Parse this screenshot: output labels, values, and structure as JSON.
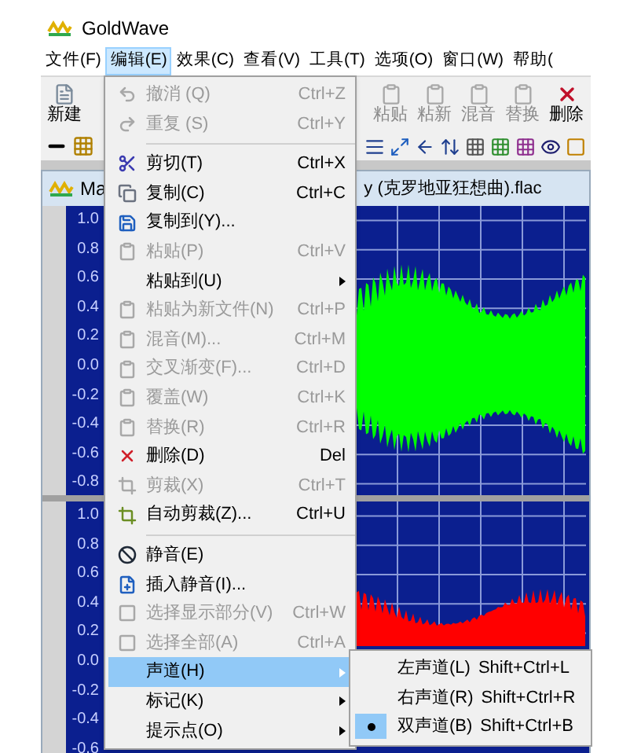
{
  "app": {
    "title": "GoldWave"
  },
  "menubar": [
    {
      "label": "文件(F)",
      "selected": false
    },
    {
      "label": "编辑(E)",
      "selected": true
    },
    {
      "label": "效果(C)",
      "selected": false
    },
    {
      "label": "查看(V)",
      "selected": false
    },
    {
      "label": "工具(T)",
      "selected": false
    },
    {
      "label": "选项(O)",
      "selected": false
    },
    {
      "label": "窗口(W)",
      "selected": false
    },
    {
      "label": "帮助(",
      "selected": false
    }
  ],
  "toolbar_left": [
    {
      "label": "新建",
      "disabled": false
    }
  ],
  "toolbar_right": [
    {
      "label": "粘贴",
      "disabled": true
    },
    {
      "label": "粘新",
      "disabled": true
    },
    {
      "label": "混音",
      "disabled": true
    },
    {
      "label": "替换",
      "disabled": true
    },
    {
      "label": "删除",
      "disabled": false
    }
  ],
  "document": {
    "title_start": "Ma",
    "title_end": "y (克罗地亚狂想曲).flac",
    "top_axis": [
      "1.0",
      "0.8",
      "0.6",
      "0.4",
      "0.2",
      "0.0",
      "-0.2",
      "-0.4",
      "-0.6",
      "-0.8"
    ],
    "bottom_axis": [
      "1.0",
      "0.8",
      "0.6",
      "0.4",
      "0.2",
      "0.0",
      "-0.2",
      "-0.4",
      "-0.6"
    ]
  },
  "edit_menu": {
    "items": [
      {
        "kind": "item",
        "label": "撤消 (Q)",
        "shortcut": "Ctrl+Z",
        "disabled": true,
        "selected": false
      },
      {
        "kind": "item",
        "label": "重复 (S)",
        "shortcut": "Ctrl+Y",
        "disabled": true,
        "selected": false
      },
      {
        "kind": "separator"
      },
      {
        "kind": "item",
        "label": "剪切(T)",
        "shortcut": "Ctrl+X",
        "disabled": false,
        "selected": false
      },
      {
        "kind": "item",
        "label": "复制(C)",
        "shortcut": "Ctrl+C",
        "disabled": false,
        "selected": false
      },
      {
        "kind": "item",
        "label": "复制到(Y)...",
        "disabled": false,
        "selected": false
      },
      {
        "kind": "item",
        "label": "粘贴(P)",
        "shortcut": "Ctrl+V",
        "disabled": true,
        "selected": false
      },
      {
        "kind": "submenu",
        "label": "粘贴到(U)",
        "disabled": false,
        "selected": false
      },
      {
        "kind": "item",
        "label": "粘贴为新文件(N)",
        "shortcut": "Ctrl+P",
        "disabled": true,
        "selected": false
      },
      {
        "kind": "item",
        "label": "混音(M)...",
        "shortcut": "Ctrl+M",
        "disabled": true,
        "selected": false
      },
      {
        "kind": "item",
        "label": "交叉渐变(F)...",
        "shortcut": "Ctrl+D",
        "disabled": true,
        "selected": false
      },
      {
        "kind": "item",
        "label": "覆盖(W)",
        "shortcut": "Ctrl+K",
        "disabled": true,
        "selected": false
      },
      {
        "kind": "item",
        "label": "替换(R)",
        "shortcut": "Ctrl+R",
        "disabled": true,
        "selected": false
      },
      {
        "kind": "item",
        "label": "删除(D)",
        "shortcut": "Del",
        "disabled": false,
        "selected": false
      },
      {
        "kind": "item",
        "label": "剪裁(X)",
        "shortcut": "Ctrl+T",
        "disabled": true,
        "selected": false
      },
      {
        "kind": "item",
        "label": "自动剪裁(Z)...",
        "shortcut": "Ctrl+U",
        "disabled": false,
        "selected": false
      },
      {
        "kind": "separator"
      },
      {
        "kind": "item",
        "label": "静音(E)",
        "disabled": false,
        "selected": false
      },
      {
        "kind": "item",
        "label": "插入静音(I)...",
        "disabled": false,
        "selected": false
      },
      {
        "kind": "item",
        "label": "选择显示部分(V)",
        "shortcut": "Ctrl+W",
        "disabled": true,
        "selected": false
      },
      {
        "kind": "item",
        "label": "选择全部(A)",
        "shortcut": "Ctrl+A",
        "disabled": true,
        "selected": false
      },
      {
        "kind": "submenu",
        "label": "声道(H)",
        "disabled": false,
        "selected": true
      },
      {
        "kind": "submenu",
        "label": "标记(K)",
        "disabled": false,
        "selected": false
      },
      {
        "kind": "submenu",
        "label": "提示点(O)",
        "disabled": false,
        "selected": false
      }
    ]
  },
  "channel_submenu": {
    "items": [
      {
        "label": "左声道(L)",
        "shortcut": "Shift+Ctrl+L",
        "checked": false
      },
      {
        "label": "右声道(R)",
        "shortcut": "Shift+Ctrl+R",
        "checked": false
      },
      {
        "label": "双声道(B)",
        "shortcut": "Shift+Ctrl+B",
        "checked": true
      }
    ]
  }
}
